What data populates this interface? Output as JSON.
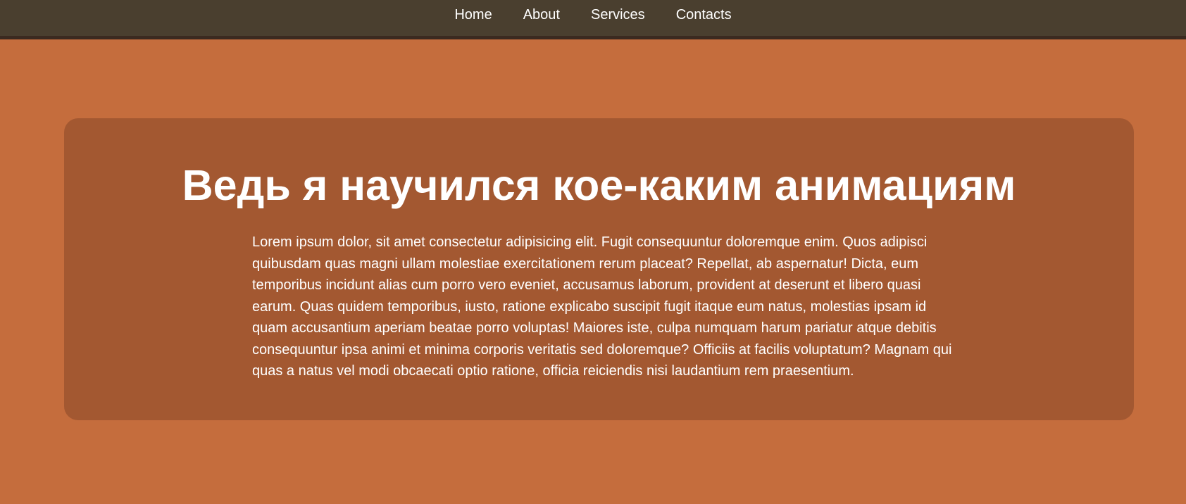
{
  "nav": {
    "items": [
      {
        "label": "Home"
      },
      {
        "label": "About"
      },
      {
        "label": "Services"
      },
      {
        "label": "Contacts"
      }
    ]
  },
  "hero": {
    "title": "Ведь я научился кое-каким анимациям",
    "paragraph": "Lorem ipsum dolor, sit amet consectetur adipisicing elit. Fugit consequuntur doloremque enim. Quos adipisci quibusdam quas magni ullam molestiae exercitationem rerum placeat? Repellat, ab aspernatur! Dicta, eum temporibus incidunt alias cum porro vero eveniet, accusamus laborum, provident at deserunt et libero quasi earum. Quas quidem temporibus, iusto, ratione explicabo suscipit fugit itaque eum natus, molestias ipsam id quam accusantium aperiam beatae porro voluptas! Maiores iste, culpa numquam harum pariatur atque debitis consequuntur ipsa animi et minima corporis veritatis sed doloremque? Officiis at facilis voluptatum? Magnam qui quas a natus vel modi obcaecati optio ratione, officia reiciendis nisi laudantium rem praesentium."
  },
  "colors": {
    "page_background": "#c56d3d",
    "nav_background": "#4a3f2f",
    "card_background": "#a35831",
    "text": "#ffffff"
  }
}
